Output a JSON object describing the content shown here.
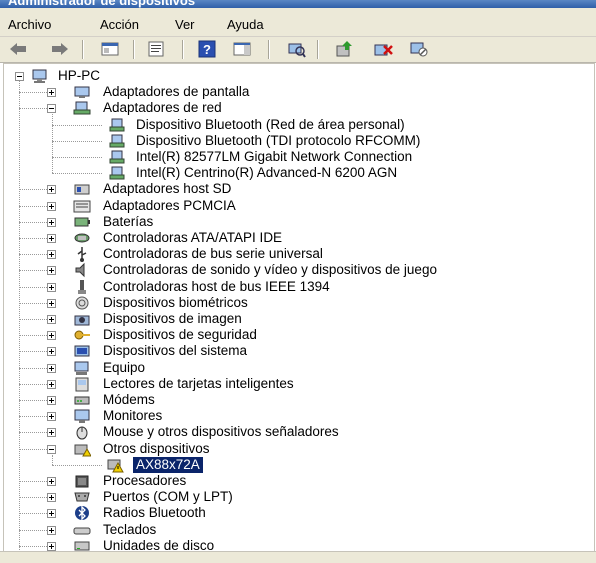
{
  "window": {
    "title": "Administrador de dispositivos"
  },
  "menu": [
    "Archivo",
    "Acción",
    "Ver",
    "Ayuda"
  ],
  "toolbar": [
    {
      "icon": "back-arrow-icon"
    },
    {
      "icon": "forward-arrow-icon"
    },
    {
      "icon": "show-hide-console-tree-icon"
    },
    {
      "icon": "properties-icon"
    },
    {
      "icon": "help-icon"
    },
    {
      "icon": "action-pane-icon"
    },
    {
      "icon": "scan-hardware-changes-icon"
    },
    {
      "icon": "update-driver-icon"
    },
    {
      "icon": "uninstall-icon"
    },
    {
      "icon": "disable-device-icon"
    }
  ],
  "tree": {
    "root": "HP-PC",
    "categories": [
      {
        "label": "Adaptadores de pantalla",
        "icon": "display-adapter-icon",
        "expanded": false
      },
      {
        "label": "Adaptadores de red",
        "icon": "network-adapter-icon",
        "expanded": true,
        "children": [
          "Dispositivo Bluetooth (Red de área personal)",
          "Dispositivo Bluetooth (TDI protocolo RFCOMM)",
          "Intel(R) 82577LM Gigabit Network Connection",
          "Intel(R) Centrino(R) Advanced-N 6200 AGN"
        ]
      },
      {
        "label": "Adaptadores host SD",
        "icon": "sd-host-icon",
        "expanded": false
      },
      {
        "label": "Adaptadores PCMCIA",
        "icon": "pcmcia-icon",
        "expanded": false
      },
      {
        "label": "Baterías",
        "icon": "battery-icon",
        "expanded": false
      },
      {
        "label": "Controladoras ATA/ATAPI IDE",
        "icon": "ide-controller-icon",
        "expanded": false
      },
      {
        "label": "Controladoras de bus serie universal",
        "icon": "usb-icon",
        "expanded": false
      },
      {
        "label": "Controladoras de sonido y vídeo y dispositivos de juego",
        "icon": "speaker-icon",
        "expanded": false
      },
      {
        "label": "Controladoras host de bus IEEE 1394",
        "icon": "firewire-icon",
        "expanded": false
      },
      {
        "label": "Dispositivos biométricos",
        "icon": "fingerprint-icon",
        "expanded": false
      },
      {
        "label": "Dispositivos de imagen",
        "icon": "camera-icon",
        "expanded": false
      },
      {
        "label": "Dispositivos de seguridad",
        "icon": "key-icon",
        "expanded": false
      },
      {
        "label": "Dispositivos del sistema",
        "icon": "system-device-icon",
        "expanded": false
      },
      {
        "label": "Equipo",
        "icon": "computer-icon",
        "expanded": false
      },
      {
        "label": "Lectores de tarjetas inteligentes",
        "icon": "smart-card-icon",
        "expanded": false
      },
      {
        "label": "Módems",
        "icon": "modem-icon",
        "expanded": false
      },
      {
        "label": "Monitores",
        "icon": "monitor-icon",
        "expanded": false
      },
      {
        "label": "Mouse y otros dispositivos señaladores",
        "icon": "mouse-icon",
        "expanded": false
      },
      {
        "label": "Otros dispositivos",
        "icon": "unknown-device-icon",
        "expanded": true,
        "children": [
          "AX88x72A"
        ]
      },
      {
        "label": "Procesadores",
        "icon": "processor-icon",
        "expanded": false
      },
      {
        "label": "Puertos (COM y LPT)",
        "icon": "port-icon",
        "expanded": false
      },
      {
        "label": "Radios Bluetooth",
        "icon": "bluetooth-icon",
        "expanded": false
      },
      {
        "label": "Teclados",
        "icon": "keyboard-icon",
        "expanded": false
      },
      {
        "label": "Unidades de disco",
        "icon": "disk-drive-icon",
        "expanded": false
      }
    ],
    "selected": "AX88x72A"
  },
  "colors": {
    "selection": "#0a246a",
    "chrome": "#ece9d8",
    "titlebar": "#2f5fa8"
  }
}
